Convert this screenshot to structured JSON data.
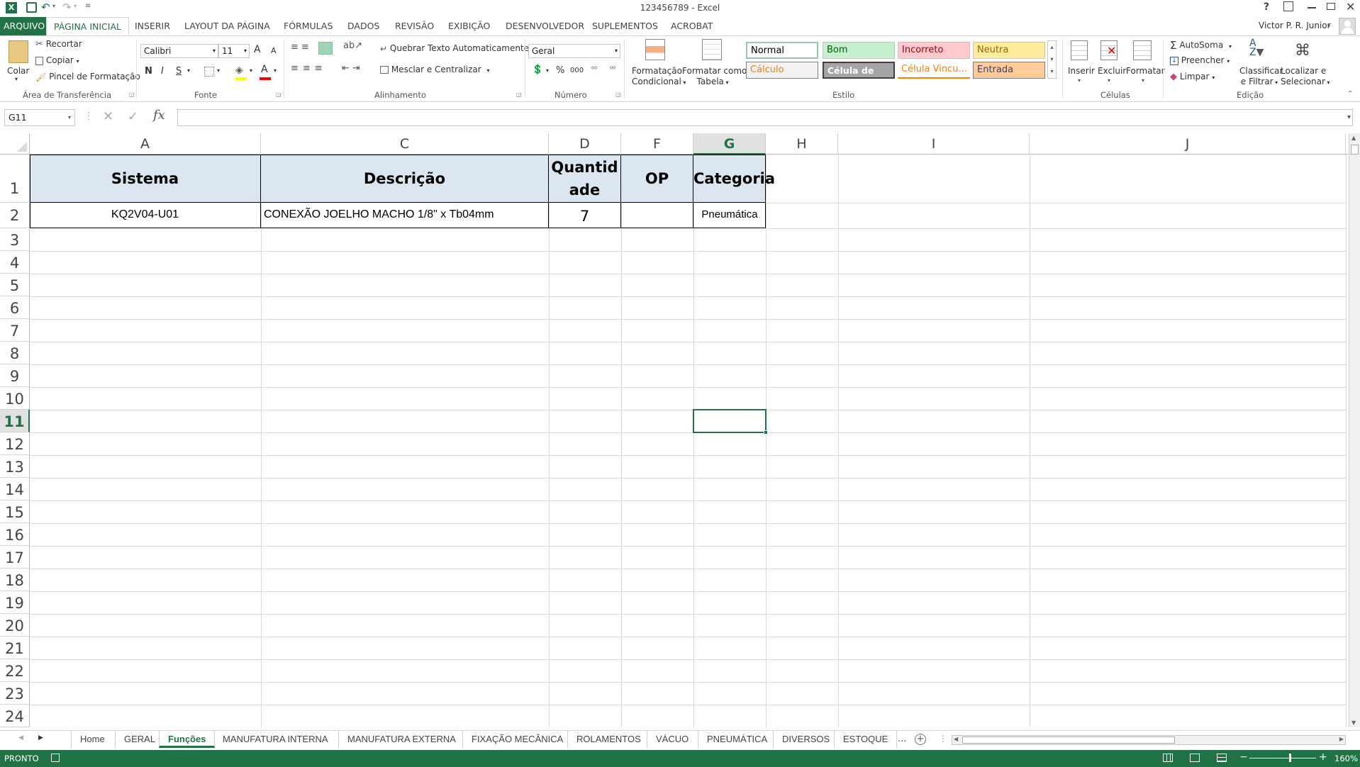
{
  "app": {
    "window_title": "123456789 - Excel",
    "help": "?",
    "user": "Victor P. R. Junior"
  },
  "ribbon_tabs": [
    {
      "label": "ARQUIVO"
    },
    {
      "label": "PÁGINA INICIAL"
    },
    {
      "label": "INSERIR"
    },
    {
      "label": "LAYOUT DA PÁGINA"
    },
    {
      "label": "FÓRMULAS"
    },
    {
      "label": "DADOS"
    },
    {
      "label": "REVISÃO"
    },
    {
      "label": "EXIBIÇÃO"
    },
    {
      "label": "DESENVOLVEDOR"
    },
    {
      "label": "SUPLEMENTOS"
    },
    {
      "label": "ACROBAT"
    }
  ],
  "clipboard": {
    "paste": "Colar",
    "cut": "Recortar",
    "copy": "Copiar",
    "format_painter": "Pincel de Formatação",
    "group": "Área de Transferência"
  },
  "font": {
    "name": "Calibri",
    "size": "11",
    "bold": "N",
    "italic": "I",
    "underline": "S",
    "grow": "A",
    "shrink": "A",
    "color_letter": "A",
    "group": "Fonte"
  },
  "alignment": {
    "wrap": "Quebrar Texto Automaticamente",
    "merge": "Mesclar e Centralizar",
    "group": "Alinhamento"
  },
  "number": {
    "format": "Geral",
    "percent": "%",
    "thousands": "000",
    "group": "Número"
  },
  "styles": {
    "conditional": "Formatação Condicional",
    "conditional_l1": "Formatação",
    "conditional_l2": "Condicional",
    "as_table_l1": "Formatar como",
    "as_table_l2": "Tabela",
    "normal": "Normal",
    "bom": "Bom",
    "incorreto": "Incorreto",
    "neutra": "Neutra",
    "calculo": "Cálculo",
    "celula_ve": "Célula de Ve...",
    "celula_vinc": "Célula Vincu...",
    "entrada": "Entrada",
    "group": "Estilo"
  },
  "cells": {
    "insert": "Inserir",
    "delete": "Excluir",
    "format": "Formatar",
    "group": "Células"
  },
  "editing": {
    "autosum": "AutoSoma",
    "fill": "Preencher",
    "clear": "Limpar",
    "sort_l1": "Classificar",
    "sort_l2": "e Filtrar",
    "find_l1": "Localizar e",
    "find_l2": "Selecionar",
    "group": "Edição"
  },
  "formula_bar": {
    "name_box": "G11",
    "fx": "fx",
    "value": ""
  },
  "columns": [
    "A",
    "C",
    "D",
    "F",
    "G",
    "H",
    "I",
    "J"
  ],
  "rows": [
    "1",
    "2",
    "3",
    "4",
    "5",
    "6",
    "7",
    "8",
    "9",
    "10",
    "11",
    "12",
    "13",
    "14",
    "15",
    "16",
    "17",
    "18",
    "19",
    "20",
    "21",
    "22",
    "23",
    "24"
  ],
  "active_cell": "G11",
  "table": {
    "headers": {
      "a": "Sistema",
      "c": "Descrição",
      "d_l1": "Quantid",
      "d_l2": "ade",
      "f": "OP",
      "g": "Categoria"
    },
    "row2": {
      "a": "KQ2V04-U01",
      "c": "CONEXÃO JOELHO MACHO 1/8\" x Tb04mm",
      "d": "7",
      "f": "",
      "g": "Pneumática"
    },
    "header_fill": "#dce6f1"
  },
  "sheet_tabs": [
    {
      "label": "Home"
    },
    {
      "label": "GERAL"
    },
    {
      "label": "Funções"
    },
    {
      "label": "MANUFATURA INTERNA"
    },
    {
      "label": "MANUFATURA EXTERNA"
    },
    {
      "label": "FIXAÇÃO MECÂNICA"
    },
    {
      "label": "ROLAMENTOS"
    },
    {
      "label": "VÁCUO"
    },
    {
      "label": "PNEUMÁTICA"
    },
    {
      "label": "DIVERSOS"
    },
    {
      "label": "ESTOQUE"
    }
  ],
  "sheet_more": "...",
  "status": {
    "ready": "PRONTO",
    "zoom": "160%"
  },
  "colors": {
    "excel_green": "#217346",
    "active_tab_text": "#217346"
  }
}
